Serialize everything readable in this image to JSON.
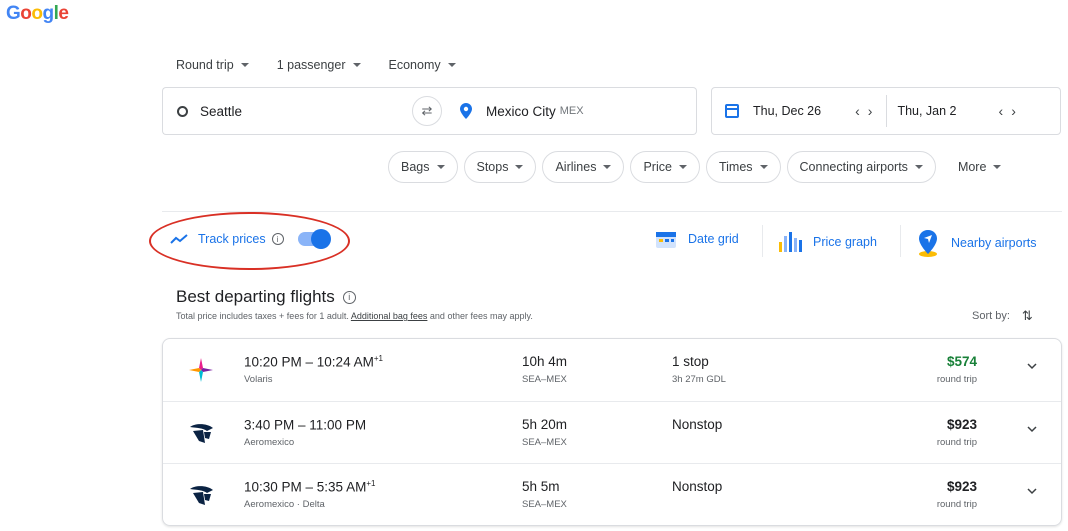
{
  "logo": {
    "letters": [
      "G",
      "o",
      "o",
      "g",
      "l",
      "e"
    ],
    "colors": [
      "#4285f4",
      "#ea4335",
      "#fbbc05",
      "#4285f4",
      "#34a853",
      "#ea4335"
    ]
  },
  "search": {
    "trip_type": "Round trip",
    "passengers": "1 passenger",
    "cabin": "Economy",
    "origin": "Seattle",
    "destination": "Mexico City",
    "destination_code": "MEX",
    "depart_date": "Thu, Dec 26",
    "return_date": "Thu, Jan 2"
  },
  "filters": [
    "Bags",
    "Stops",
    "Airlines",
    "Price",
    "Times",
    "Connecting airports",
    "More"
  ],
  "track": {
    "label": "Track prices",
    "enabled": true
  },
  "tools": {
    "date_grid": "Date grid",
    "price_graph": "Price graph",
    "nearby": "Nearby airports"
  },
  "results_header": {
    "title": "Best departing flights",
    "note_prefix": "Total price includes taxes + fees for 1 adult. ",
    "note_link": "Additional bag fees",
    "note_suffix": " and other fees may apply.",
    "sort_label": "Sort by:"
  },
  "flights": [
    {
      "times": "10:20 PM – 10:24 AM",
      "plus": "+1",
      "airline": "Volaris",
      "duration": "10h 4m",
      "route": "SEA–MEX",
      "stops": "1 stop",
      "stop_info": "3h 27m GDL",
      "price": "$574",
      "price_type": "round trip"
    },
    {
      "times": "3:40 PM – 11:00 PM",
      "plus": "",
      "airline": "Aeromexico",
      "duration": "5h 20m",
      "route": "SEA–MEX",
      "stops": "Nonstop",
      "stop_info": "",
      "price": "$923",
      "price_type": "round trip"
    },
    {
      "times": "10:30 PM – 5:35 AM",
      "plus": "+1",
      "airline": "Aeromexico · Delta",
      "duration": "5h 5m",
      "route": "SEA–MEX",
      "stops": "Nonstop",
      "stop_info": "",
      "price": "$923",
      "price_type": "round trip"
    }
  ]
}
